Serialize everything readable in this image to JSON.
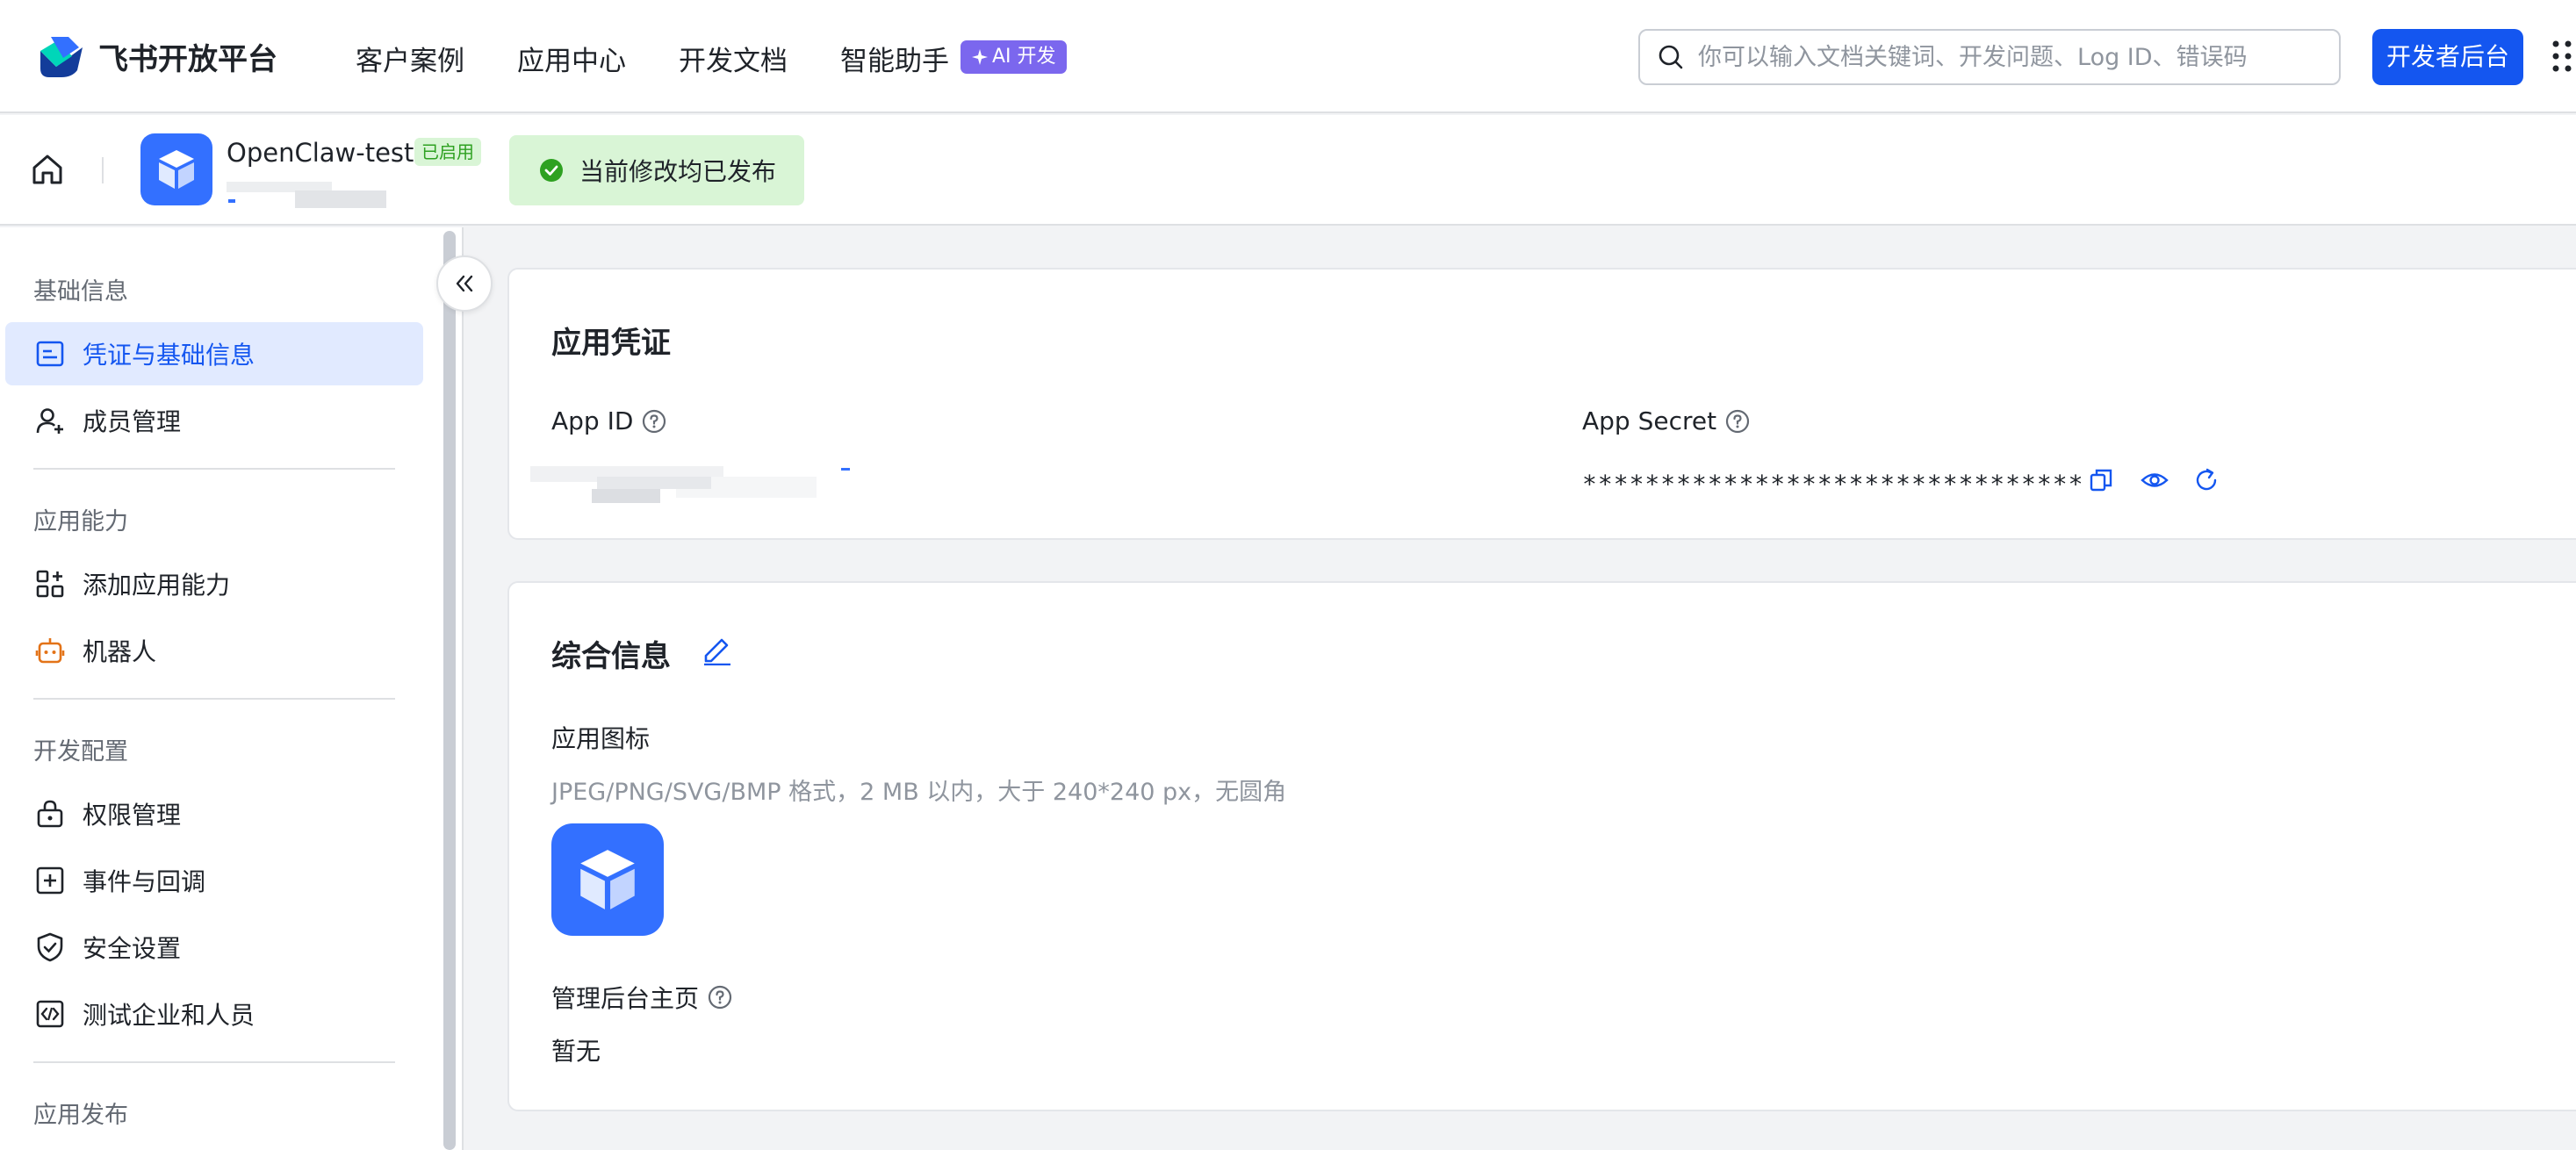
{
  "brand": {
    "name": "飞书开放平台"
  },
  "nav": {
    "items": [
      "客户案例",
      "应用中心",
      "开发文档",
      "智能助手"
    ],
    "ai_badge": "AI 开发"
  },
  "search": {
    "placeholder": "你可以输入文档关键词、开发问题、Log ID、错误码"
  },
  "dev_button": "开发者后台",
  "app": {
    "name": "OpenClaw-test",
    "status": "已启用",
    "publish_note": "当前修改均已发布"
  },
  "sidebar": {
    "groups": [
      {
        "title": "基础信息",
        "items": [
          {
            "label": "凭证与基础信息",
            "icon": "credential-icon",
            "active": true
          },
          {
            "label": "成员管理",
            "icon": "member-add-icon"
          }
        ]
      },
      {
        "title": "应用能力",
        "items": [
          {
            "label": "添加应用能力",
            "icon": "apps-add-icon"
          },
          {
            "label": "机器人",
            "icon": "robot-icon"
          }
        ]
      },
      {
        "title": "开发配置",
        "items": [
          {
            "label": "权限管理",
            "icon": "lock-icon"
          },
          {
            "label": "事件与回调",
            "icon": "event-icon"
          },
          {
            "label": "安全设置",
            "icon": "shield-icon"
          },
          {
            "label": "测试企业和人员",
            "icon": "code-box-icon"
          }
        ]
      },
      {
        "title": "应用发布",
        "items": []
      }
    ]
  },
  "credentials": {
    "title": "应用凭证",
    "app_id_label": "App ID",
    "app_secret_label": "App Secret",
    "app_secret_value": "********************************"
  },
  "general": {
    "title": "综合信息",
    "icon_label": "应用图标",
    "icon_hint": "JPEG/PNG/SVG/BMP 格式，2 MB 以内，大于 240*240 px，无圆角",
    "admin_home_label": "管理后台主页",
    "admin_home_value": "暂无"
  },
  "colors": {
    "primary": "#1456f0",
    "success": "#2ea121",
    "active_bg": "#e1eaff",
    "ai": "#7b67ee"
  }
}
